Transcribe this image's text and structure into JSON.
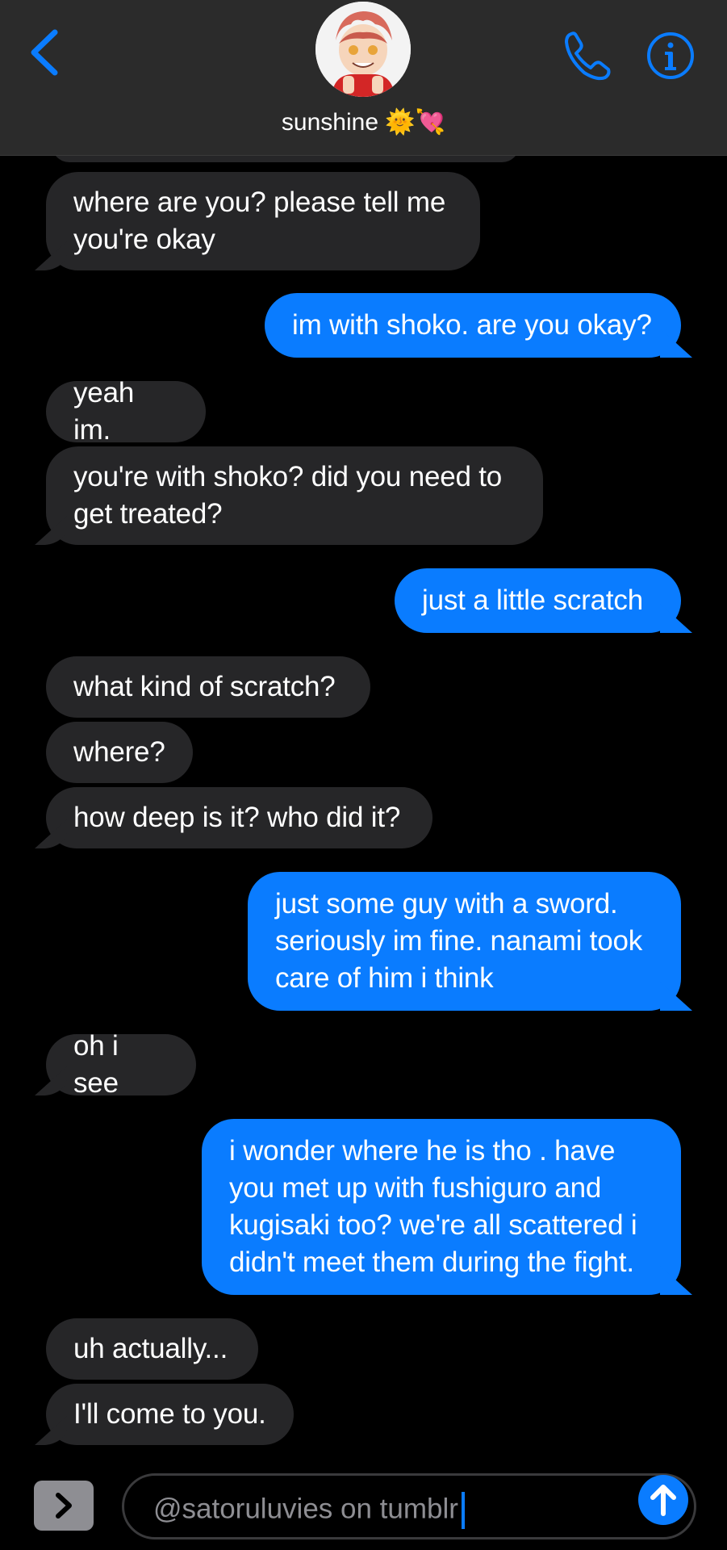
{
  "header": {
    "contact_name": "sunshine",
    "contact_emoji": "🌞💘",
    "back_icon": "chevron-left-icon",
    "call_icon": "phone-icon",
    "info_icon": "info-icon"
  },
  "messages": [
    {
      "from": "them",
      "text": "where are you? please tell me\nyou're okay"
    },
    {
      "from": "me",
      "text": "im with shoko. are you okay?"
    },
    {
      "from": "them",
      "text": "yeah im."
    },
    {
      "from": "them",
      "text": "you're with shoko? did you need to\nget treated?"
    },
    {
      "from": "me",
      "text": "just a little scratch"
    },
    {
      "from": "them",
      "text": "what kind of scratch?"
    },
    {
      "from": "them",
      "text": "where?"
    },
    {
      "from": "them",
      "text": "how deep is it? who did it?"
    },
    {
      "from": "me",
      "text": "just some guy with a sword.\nseriously im fine. nanami took\ncare of him i think"
    },
    {
      "from": "them",
      "text": "oh i see"
    },
    {
      "from": "me",
      "text": "i wonder where he is tho . have\nyou met up with fushiguro and\nkugisaki too? we're all scattered i\ndidn't meet them during the fight."
    },
    {
      "from": "them",
      "text": "uh actually..."
    },
    {
      "from": "them",
      "text": "I'll come to you."
    }
  ],
  "composer": {
    "text": "@satoruluvies on tumblr",
    "apps_icon": "chevron-right-icon",
    "send_icon": "arrow-up-icon"
  },
  "colors": {
    "sent_bubble": "#0a7cff",
    "received_bubble": "#262628",
    "header_bg": "#2b2b2b",
    "accent": "#0a7cff"
  }
}
